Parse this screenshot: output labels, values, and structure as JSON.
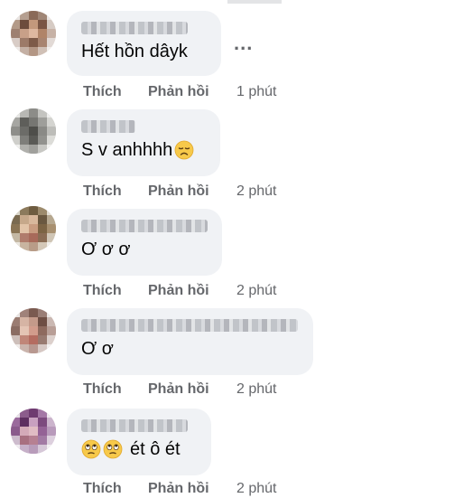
{
  "comments": [
    {
      "text": "Hết hồn dâyk",
      "emoji": [],
      "actions": {
        "like": "Thích",
        "reply": "Phản hồi",
        "time": "1 phút"
      }
    },
    {
      "text": "S v anhhhh",
      "emoji": [
        "disappointed-face"
      ],
      "actions": {
        "like": "Thích",
        "reply": "Phản hồi",
        "time": "2 phút"
      }
    },
    {
      "text": "Ơ ơ ơ",
      "emoji": [],
      "actions": {
        "like": "Thích",
        "reply": "Phản hồi",
        "time": "2 phút"
      }
    },
    {
      "text": "Ơ ơ",
      "emoji": [],
      "actions": {
        "like": "Thích",
        "reply": "Phản hồi",
        "time": "2 phút"
      }
    },
    {
      "text": "ét ô ét",
      "emoji": [
        "rolling-eyes-face",
        "rolling-eyes-face"
      ],
      "actions": {
        "like": "Thích",
        "reply": "Phản hồi",
        "time": "2 phút"
      }
    }
  ],
  "more_menu": "...",
  "colors": {
    "bubble": "#f0f2f5",
    "meta_text": "#65676b",
    "text": "#050505"
  }
}
